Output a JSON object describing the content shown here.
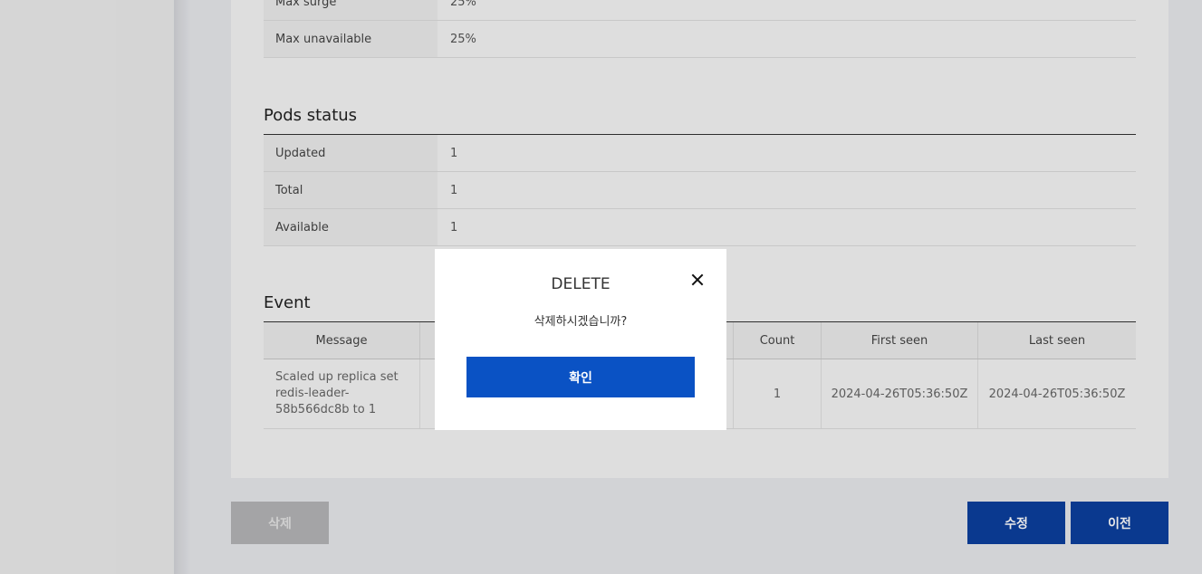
{
  "strategy": {
    "rows": [
      {
        "key": "Max surge",
        "value": "25%"
      },
      {
        "key": "Max unavailable",
        "value": "25%"
      }
    ]
  },
  "pods_status": {
    "title": "Pods status",
    "rows": [
      {
        "key": "Updated",
        "value": "1"
      },
      {
        "key": "Total",
        "value": "1"
      },
      {
        "key": "Available",
        "value": "1"
      }
    ]
  },
  "event": {
    "title": "Event",
    "columns": [
      "Message",
      "",
      "Count",
      "First seen",
      "Last seen"
    ],
    "rows": [
      {
        "message": "Scaled up replica set redis-leader-58b566dc8b to 1",
        "count": "1",
        "first_seen": "2024-04-26T05:36:50Z",
        "last_seen": "2024-04-26T05:36:50Z"
      }
    ]
  },
  "actions": {
    "delete_label": "삭제",
    "edit_label": "수정",
    "prev_label": "이전"
  },
  "modal": {
    "title": "DELETE",
    "message": "삭제하시겠습니까?",
    "confirm_label": "확인",
    "close_icon": "close-icon"
  },
  "colors": {
    "primary_button": "#0c3f9e",
    "confirm_button": "#0a52c4",
    "disabled_button": "#b5b5b7"
  }
}
